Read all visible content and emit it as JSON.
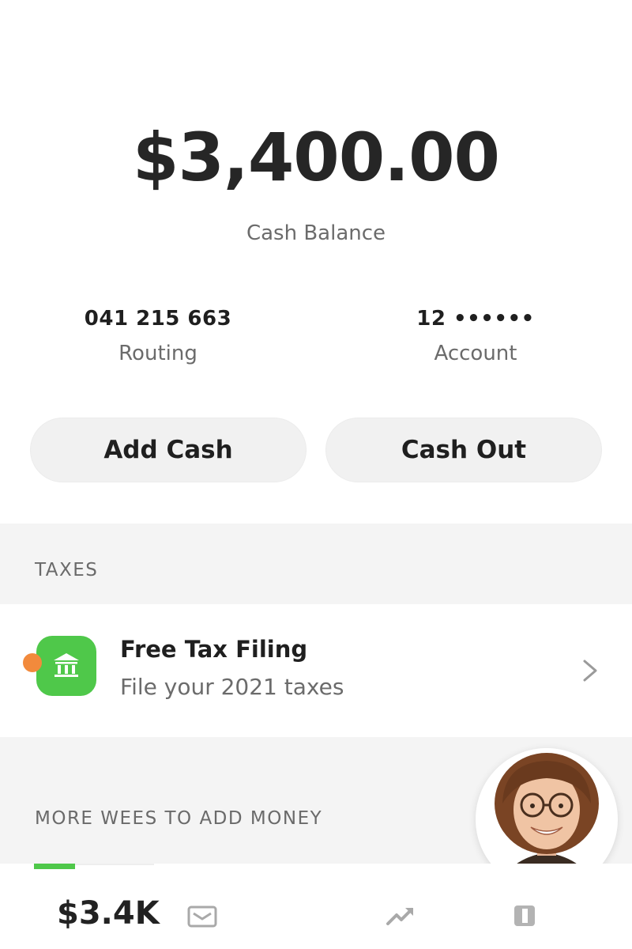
{
  "balance": {
    "amount": "$3,400.00",
    "label": "Cash Balance"
  },
  "account": {
    "routing_value": "041 215 663",
    "routing_label": "Routing",
    "account_value": "12 ••••••",
    "account_label": "Account"
  },
  "actions": {
    "add_cash": "Add Cash",
    "cash_out": "Cash Out"
  },
  "sections": {
    "taxes_header": "TAXES",
    "more_header": "MORE WEES TO ADD MONEY"
  },
  "tax_item": {
    "title": "Free Tax Filing",
    "subtitle": "File your 2021 taxes",
    "icon": "bank-icon",
    "badge_color": "#f28a3c",
    "icon_color": "#4fc84a"
  },
  "tabbar": {
    "balance_label": "$3.4K",
    "icons": [
      "envelope-icon",
      "trend-arrow-icon",
      "card-icon"
    ],
    "active_color": "#4fc84a"
  }
}
